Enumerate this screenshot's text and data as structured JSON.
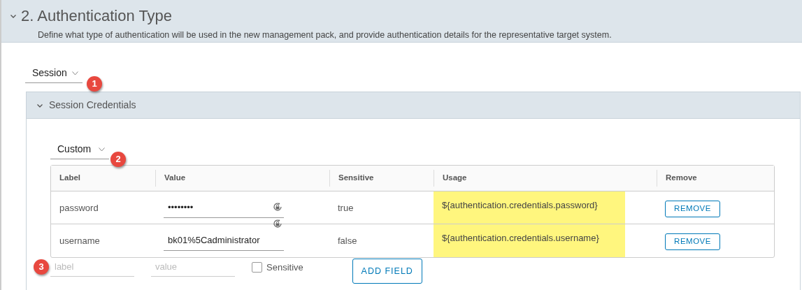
{
  "section": {
    "title": "2. Authentication Type",
    "expanded": true,
    "description": "Define what type of authentication will be used in the new management pack, and provide authentication details for the representative target system."
  },
  "auth_type": {
    "value": "Session",
    "badge": "1"
  },
  "credentials": {
    "title": "Session Credentials",
    "expanded": true,
    "preset": {
      "value": "Custom",
      "badge": "2"
    },
    "columns": [
      "Label",
      "Value",
      "Sensitive",
      "Usage",
      "Remove"
    ],
    "rows": [
      {
        "label": "password",
        "value": "••••••••",
        "sensitive": "true",
        "usage": "${authentication.credentials.password}",
        "highlighted": true,
        "remove": "REMOVE"
      },
      {
        "label": "username",
        "value": "bk01%5Cadministrator",
        "sensitive": "false",
        "usage": "${authentication.credentials.username}",
        "highlighted": true,
        "remove": "REMOVE"
      }
    ],
    "new_field": {
      "badge": "3",
      "label_placeholder": "label",
      "value_placeholder": "value",
      "sensitive_label": "Sensitive",
      "sensitive_checked": false,
      "add_button": "ADD FIELD"
    }
  }
}
